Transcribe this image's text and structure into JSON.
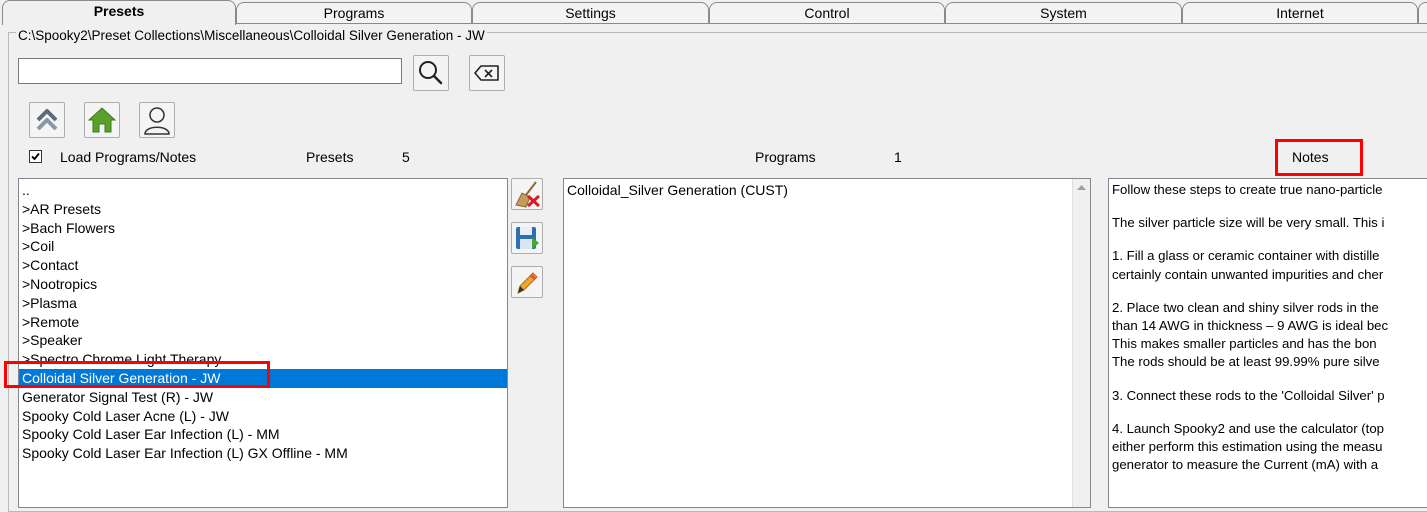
{
  "tabs": [
    {
      "label": "Presets",
      "active": true
    },
    {
      "label": "Programs",
      "active": false
    },
    {
      "label": "Settings",
      "active": false
    },
    {
      "label": "Control",
      "active": false
    },
    {
      "label": "System",
      "active": false
    },
    {
      "label": "Internet",
      "active": false
    }
  ],
  "frame": {
    "title": "C:\\Spooky2\\Preset Collections\\Miscellaneous\\Colloidal Silver Generation - JW"
  },
  "search": {
    "value": "",
    "placeholder": ""
  },
  "nav": {
    "up_icon": "double-chevron-up-icon",
    "home_icon": "home-icon",
    "user_icon": "user-icon"
  },
  "load_programs": {
    "label": "Load Programs/Notes",
    "checked": true
  },
  "presets_header": {
    "label": "Presets",
    "count": "5"
  },
  "programs_header": {
    "label": "Programs",
    "count": "1"
  },
  "notes_header": {
    "label": "Notes"
  },
  "preset_items": [
    "..",
    ">AR Presets",
    ">Bach Flowers",
    ">Coil",
    ">Contact",
    ">Nootropics",
    ">Plasma",
    ">Remote",
    ">Speaker",
    ">Spectro Chrome Light Therapy",
    "Colloidal Silver Generation - JW",
    "Generator Signal Test (R) - JW",
    "Spooky Cold Laser Acne (L) - JW",
    "Spooky Cold Laser Ear Infection (L) - MM",
    "Spooky Cold Laser Ear Infection (L) GX Offline - MM"
  ],
  "selected_index": 10,
  "program_items": [
    "Colloidal_Silver Generation (CUST)"
  ],
  "notes_lines": [
    [
      "Follow these steps to create true nano-particle"
    ],
    [
      "The silver particle size will be very small. This i"
    ],
    [
      "1. Fill a glass or ceramic container with distille",
      "certainly contain unwanted impurities and cher"
    ],
    [
      "2. Place two clean and shiny silver rods in the",
      "than 14 AWG in thickness – 9 AWG is ideal bec",
      "This makes smaller particles and has the bon",
      "The rods should be at least 99.99% pure silve"
    ],
    [
      "3. Connect these rods to the 'Colloidal Silver' p"
    ],
    [
      "4. Launch Spooky2 and use the calculator (top",
      "either perform this estimation using the measu",
      "generator to measure the Current (mA) with a"
    ]
  ],
  "colors": {
    "selection": "#0078d7",
    "highlight": "#ff0000",
    "home_green": "#5aa02c"
  }
}
